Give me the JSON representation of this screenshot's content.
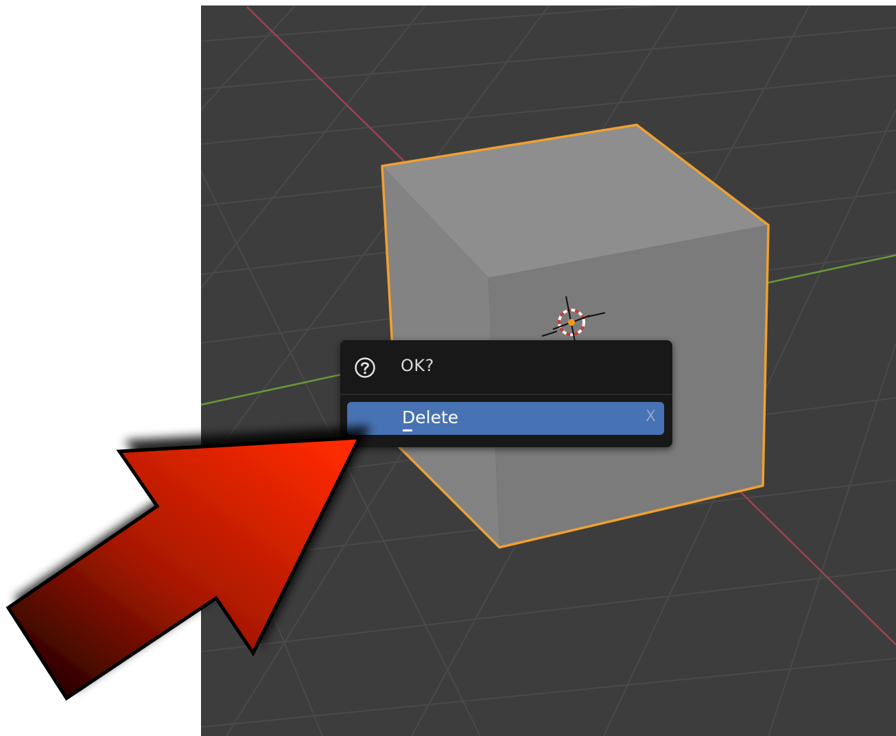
{
  "dialog": {
    "title": "OK?",
    "icon": "question-icon",
    "delete_label": "Delete",
    "shortcut": "X"
  },
  "colors": {
    "viewport_bg": "#3d3d3d",
    "grid_line": "#4a4a4a",
    "x_axis": "#a0424f",
    "y_axis": "#6a9a3a",
    "selection_outline": "#f0a030",
    "cube_front": "#7a7a7a",
    "cube_top": "#8e8e8e",
    "cube_left": "#838383",
    "dialog_bg": "#181818",
    "button_bg": "#4772b3",
    "arrow_red": "#ff2a00",
    "arrow_dark": "#2a0000"
  },
  "annotation": {
    "icon": "pointer-arrow-icon"
  }
}
